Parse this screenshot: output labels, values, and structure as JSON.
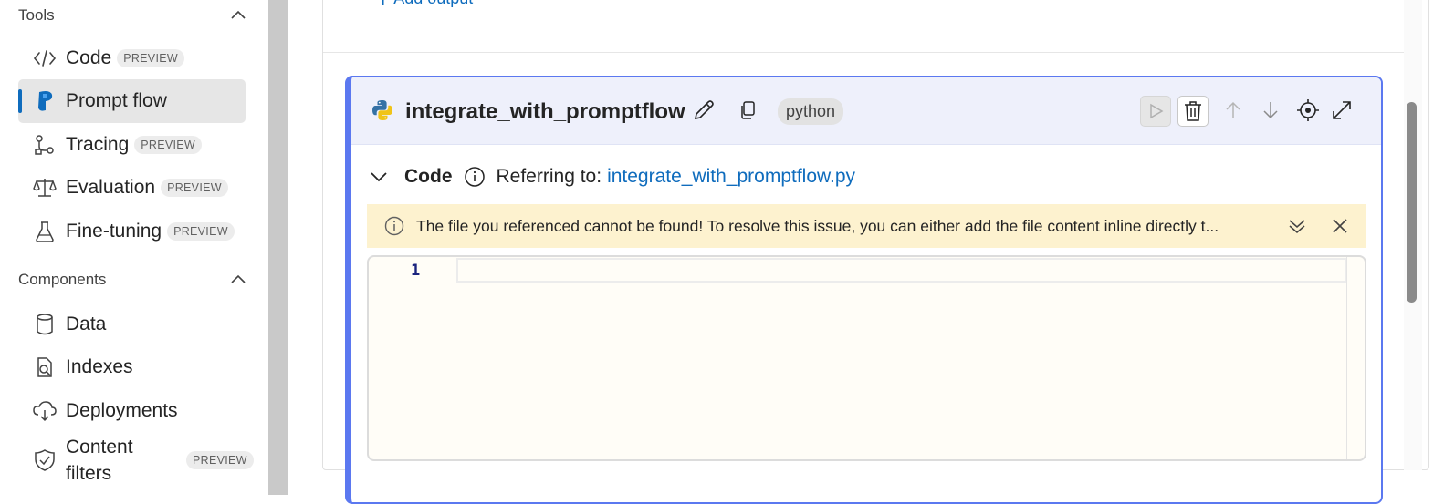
{
  "sidebar": {
    "tools_section": {
      "title": "Tools"
    },
    "tools": [
      {
        "label": "Code",
        "badge": "PREVIEW",
        "icon": "code-icon"
      },
      {
        "label": "Prompt flow",
        "badge": "",
        "icon": "prompt-flow-icon",
        "selected": true
      },
      {
        "label": "Tracing",
        "badge": "PREVIEW",
        "icon": "tracing-icon"
      },
      {
        "label": "Evaluation",
        "badge": "PREVIEW",
        "icon": "scale-icon"
      },
      {
        "label": "Fine-tuning",
        "badge": "PREVIEW",
        "icon": "beaker-icon"
      }
    ],
    "components_section": {
      "title": "Components"
    },
    "components": [
      {
        "label": "Data",
        "icon": "database-icon"
      },
      {
        "label": "Indexes",
        "icon": "document-search-icon"
      },
      {
        "label": "Deployments",
        "icon": "cloud-icon"
      },
      {
        "label_line1": "Content",
        "label_line2": "filters",
        "badge": "PREVIEW",
        "icon": "shield-check-icon"
      }
    ]
  },
  "main": {
    "add_output_label": "Add output",
    "node": {
      "title": "integrate_with_promptflow",
      "language": "python",
      "code_section_label": "Code",
      "referring_label": "Referring to:",
      "referring_file": "integrate_with_promptflow.py",
      "warning": "The file you referenced cannot be found! To resolve this issue, you can either add the file content inline directly t...",
      "editor": {
        "line_numbers": [
          "1"
        ]
      }
    }
  },
  "colors": {
    "accent": "#0f6cbd",
    "node_border": "#5b78f0",
    "warning_bg": "#fdf2cf",
    "header_bg": "#eef0fb"
  }
}
